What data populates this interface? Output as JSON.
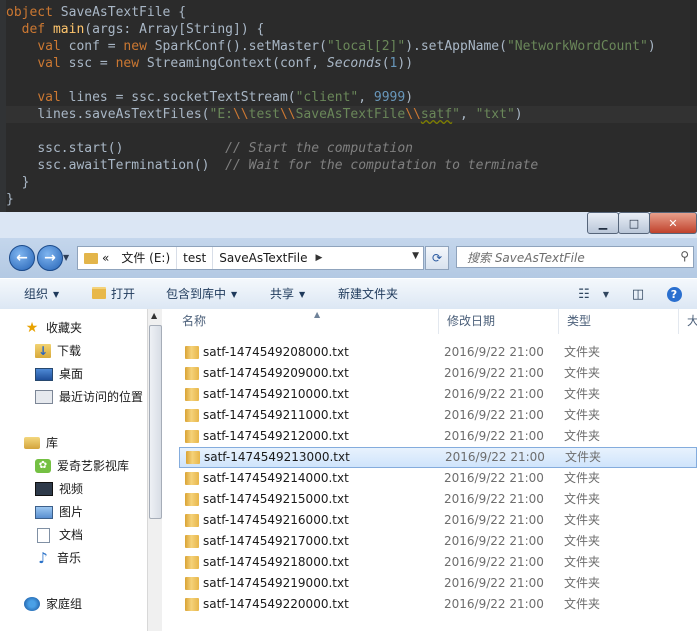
{
  "editor": {
    "lines": {
      "l1_kw": "object",
      "l1_name": " SaveAsTextFile {",
      "l2_kw": "def",
      "l2_fn": "main",
      "l2_rest": "(args: Array[String]) {",
      "l3_val": "val",
      "l3_a": " conf = ",
      "l3_new": "new",
      "l3_b": " SparkConf().setMaster(",
      "l3_s1": "\"local[2]\"",
      "l3_c": ").setAppName(",
      "l3_s2": "\"NetworkWordCount\"",
      "l3_d": ")",
      "l4_val": "val",
      "l4_a": " ssc = ",
      "l4_new": "new",
      "l4_b": " StreamingContext(conf, ",
      "l4_it": "Seconds",
      "l4_c": "(",
      "l4_num": "1",
      "l4_d": "))",
      "l6_val": "val",
      "l6_a": " lines = ssc.socketTextStream(",
      "l6_s": "\"client\"",
      "l6_b": ", ",
      "l6_num": "9999",
      "l6_c": ")",
      "l7_a": "lines.saveAsTextFiles(",
      "l7_s1": "\"E:",
      "l7_e1": "\\\\",
      "l7_s2": "test",
      "l7_e2": "\\\\",
      "l7_s3": "SaveAsTextFile",
      "l7_e3": "\\\\",
      "l7_s4": "satf",
      "l7_s5": "\"",
      "l7_b": ", ",
      "l7_s6": "\"txt\"",
      "l7_c": ")",
      "l9_a": "ssc.start()             ",
      "l9_cm": "// Start the computation",
      "l10_a": "ssc.awaitTermination()  ",
      "l10_cm": "// Wait for the computation to terminate",
      "l11": "}",
      "l12": "}"
    }
  },
  "explorer": {
    "window_buttons": {
      "minimize": "▁",
      "maximize": "□",
      "close": "✕"
    },
    "address": {
      "prefix": "«",
      "crumbs": [
        "文件 (E:)",
        "test",
        "SaveAsTextFile"
      ]
    },
    "search": {
      "placeholder": "搜索 SaveAsTextFile"
    },
    "toolbar": {
      "organize": "组织",
      "open": "打开",
      "include_in_library": "包含到库中",
      "share": "共享",
      "new_folder": "新建文件夹"
    },
    "nav": {
      "favorites": "收藏夹",
      "downloads": "下载",
      "desktop": "桌面",
      "recent": "最近访问的位置",
      "libraries": "库",
      "iqiyi": "爱奇艺影视库",
      "videos": "视频",
      "pictures": "图片",
      "documents": "文档",
      "music": "音乐",
      "homegroup": "家庭组"
    },
    "columns": {
      "name": "名称",
      "date": "修改日期",
      "type": "类型",
      "size": "大"
    },
    "files": [
      {
        "name": "satf-1474549208000.txt",
        "date": "2016/9/22 21:00",
        "type": "文件夹"
      },
      {
        "name": "satf-1474549209000.txt",
        "date": "2016/9/22 21:00",
        "type": "文件夹"
      },
      {
        "name": "satf-1474549210000.txt",
        "date": "2016/9/22 21:00",
        "type": "文件夹"
      },
      {
        "name": "satf-1474549211000.txt",
        "date": "2016/9/22 21:00",
        "type": "文件夹"
      },
      {
        "name": "satf-1474549212000.txt",
        "date": "2016/9/22 21:00",
        "type": "文件夹"
      },
      {
        "name": "satf-1474549213000.txt",
        "date": "2016/9/22 21:00",
        "type": "文件夹",
        "selected": true
      },
      {
        "name": "satf-1474549214000.txt",
        "date": "2016/9/22 21:00",
        "type": "文件夹"
      },
      {
        "name": "satf-1474549215000.txt",
        "date": "2016/9/22 21:00",
        "type": "文件夹"
      },
      {
        "name": "satf-1474549216000.txt",
        "date": "2016/9/22 21:00",
        "type": "文件夹"
      },
      {
        "name": "satf-1474549217000.txt",
        "date": "2016/9/22 21:00",
        "type": "文件夹"
      },
      {
        "name": "satf-1474549218000.txt",
        "date": "2016/9/22 21:00",
        "type": "文件夹"
      },
      {
        "name": "satf-1474549219000.txt",
        "date": "2016/9/22 21:00",
        "type": "文件夹"
      },
      {
        "name": "satf-1474549220000.txt",
        "date": "2016/9/22 21:00",
        "type": "文件夹"
      }
    ]
  }
}
